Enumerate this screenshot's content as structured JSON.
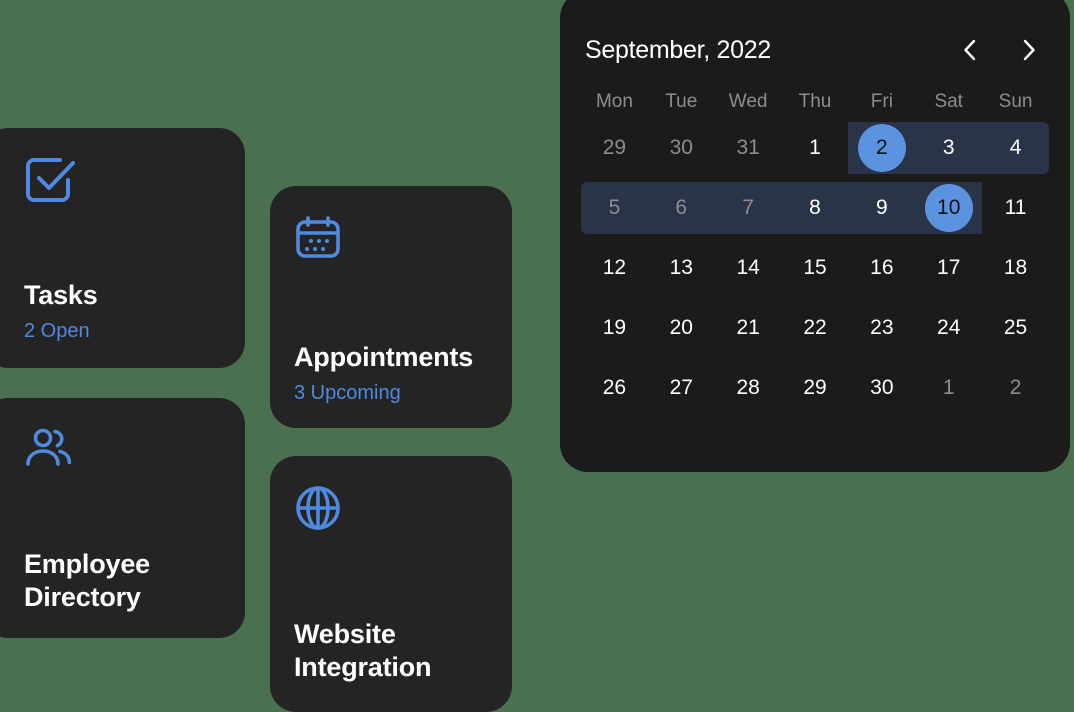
{
  "theme": {
    "page_background": "#4a7050",
    "card_background": "#242424",
    "panel_background": "#1b1b1b",
    "accent_blue": "#4f8ae0",
    "selection_blue": "#5b93e0",
    "range_band": "#2a3448",
    "muted_text": "#8d8d8d",
    "primary_text": "#ffffff"
  },
  "cards": [
    {
      "id": "tasks",
      "title": "Tasks",
      "subtitle": "2 Open",
      "icon": "checkbox-check-icon"
    },
    {
      "id": "employee-directory",
      "title": "Employee Directory",
      "subtitle": "",
      "icon": "people-icon"
    },
    {
      "id": "appointments",
      "title": "Appointments",
      "subtitle": "3 Upcoming",
      "icon": "calendar-icon"
    },
    {
      "id": "website-integration",
      "title": "Website Integration",
      "subtitle": "",
      "icon": "globe-icon"
    }
  ],
  "calendar": {
    "month_label": "September, 2022",
    "prev_label": "‹",
    "next_label": "›",
    "weekdays": [
      "Mon",
      "Tue",
      "Wed",
      "Thu",
      "Fri",
      "Sat",
      "Sun"
    ],
    "selected_range": {
      "start": "2",
      "end": "10"
    },
    "weeks": [
      [
        {
          "day": "29",
          "state": "outside"
        },
        {
          "day": "30",
          "state": "outside"
        },
        {
          "day": "31",
          "state": "outside"
        },
        {
          "day": "1",
          "state": "normal"
        },
        {
          "day": "2",
          "state": "selected"
        },
        {
          "day": "3",
          "state": "in-range"
        },
        {
          "day": "4",
          "state": "in-range"
        }
      ],
      [
        {
          "day": "5",
          "state": "in-range-muted"
        },
        {
          "day": "6",
          "state": "in-range-muted"
        },
        {
          "day": "7",
          "state": "in-range-muted"
        },
        {
          "day": "8",
          "state": "in-range"
        },
        {
          "day": "9",
          "state": "in-range"
        },
        {
          "day": "10",
          "state": "selected"
        },
        {
          "day": "11",
          "state": "normal"
        }
      ],
      [
        {
          "day": "12",
          "state": "normal"
        },
        {
          "day": "13",
          "state": "normal"
        },
        {
          "day": "14",
          "state": "normal"
        },
        {
          "day": "15",
          "state": "normal"
        },
        {
          "day": "16",
          "state": "normal"
        },
        {
          "day": "17",
          "state": "normal"
        },
        {
          "day": "18",
          "state": "normal"
        }
      ],
      [
        {
          "day": "19",
          "state": "normal"
        },
        {
          "day": "20",
          "state": "normal"
        },
        {
          "day": "21",
          "state": "normal"
        },
        {
          "day": "22",
          "state": "normal"
        },
        {
          "day": "23",
          "state": "normal"
        },
        {
          "day": "24",
          "state": "normal"
        },
        {
          "day": "25",
          "state": "normal"
        }
      ],
      [
        {
          "day": "26",
          "state": "normal"
        },
        {
          "day": "27",
          "state": "normal"
        },
        {
          "day": "28",
          "state": "normal"
        },
        {
          "day": "29",
          "state": "normal"
        },
        {
          "day": "30",
          "state": "normal"
        },
        {
          "day": "1",
          "state": "outside"
        },
        {
          "day": "2",
          "state": "outside"
        }
      ]
    ]
  }
}
